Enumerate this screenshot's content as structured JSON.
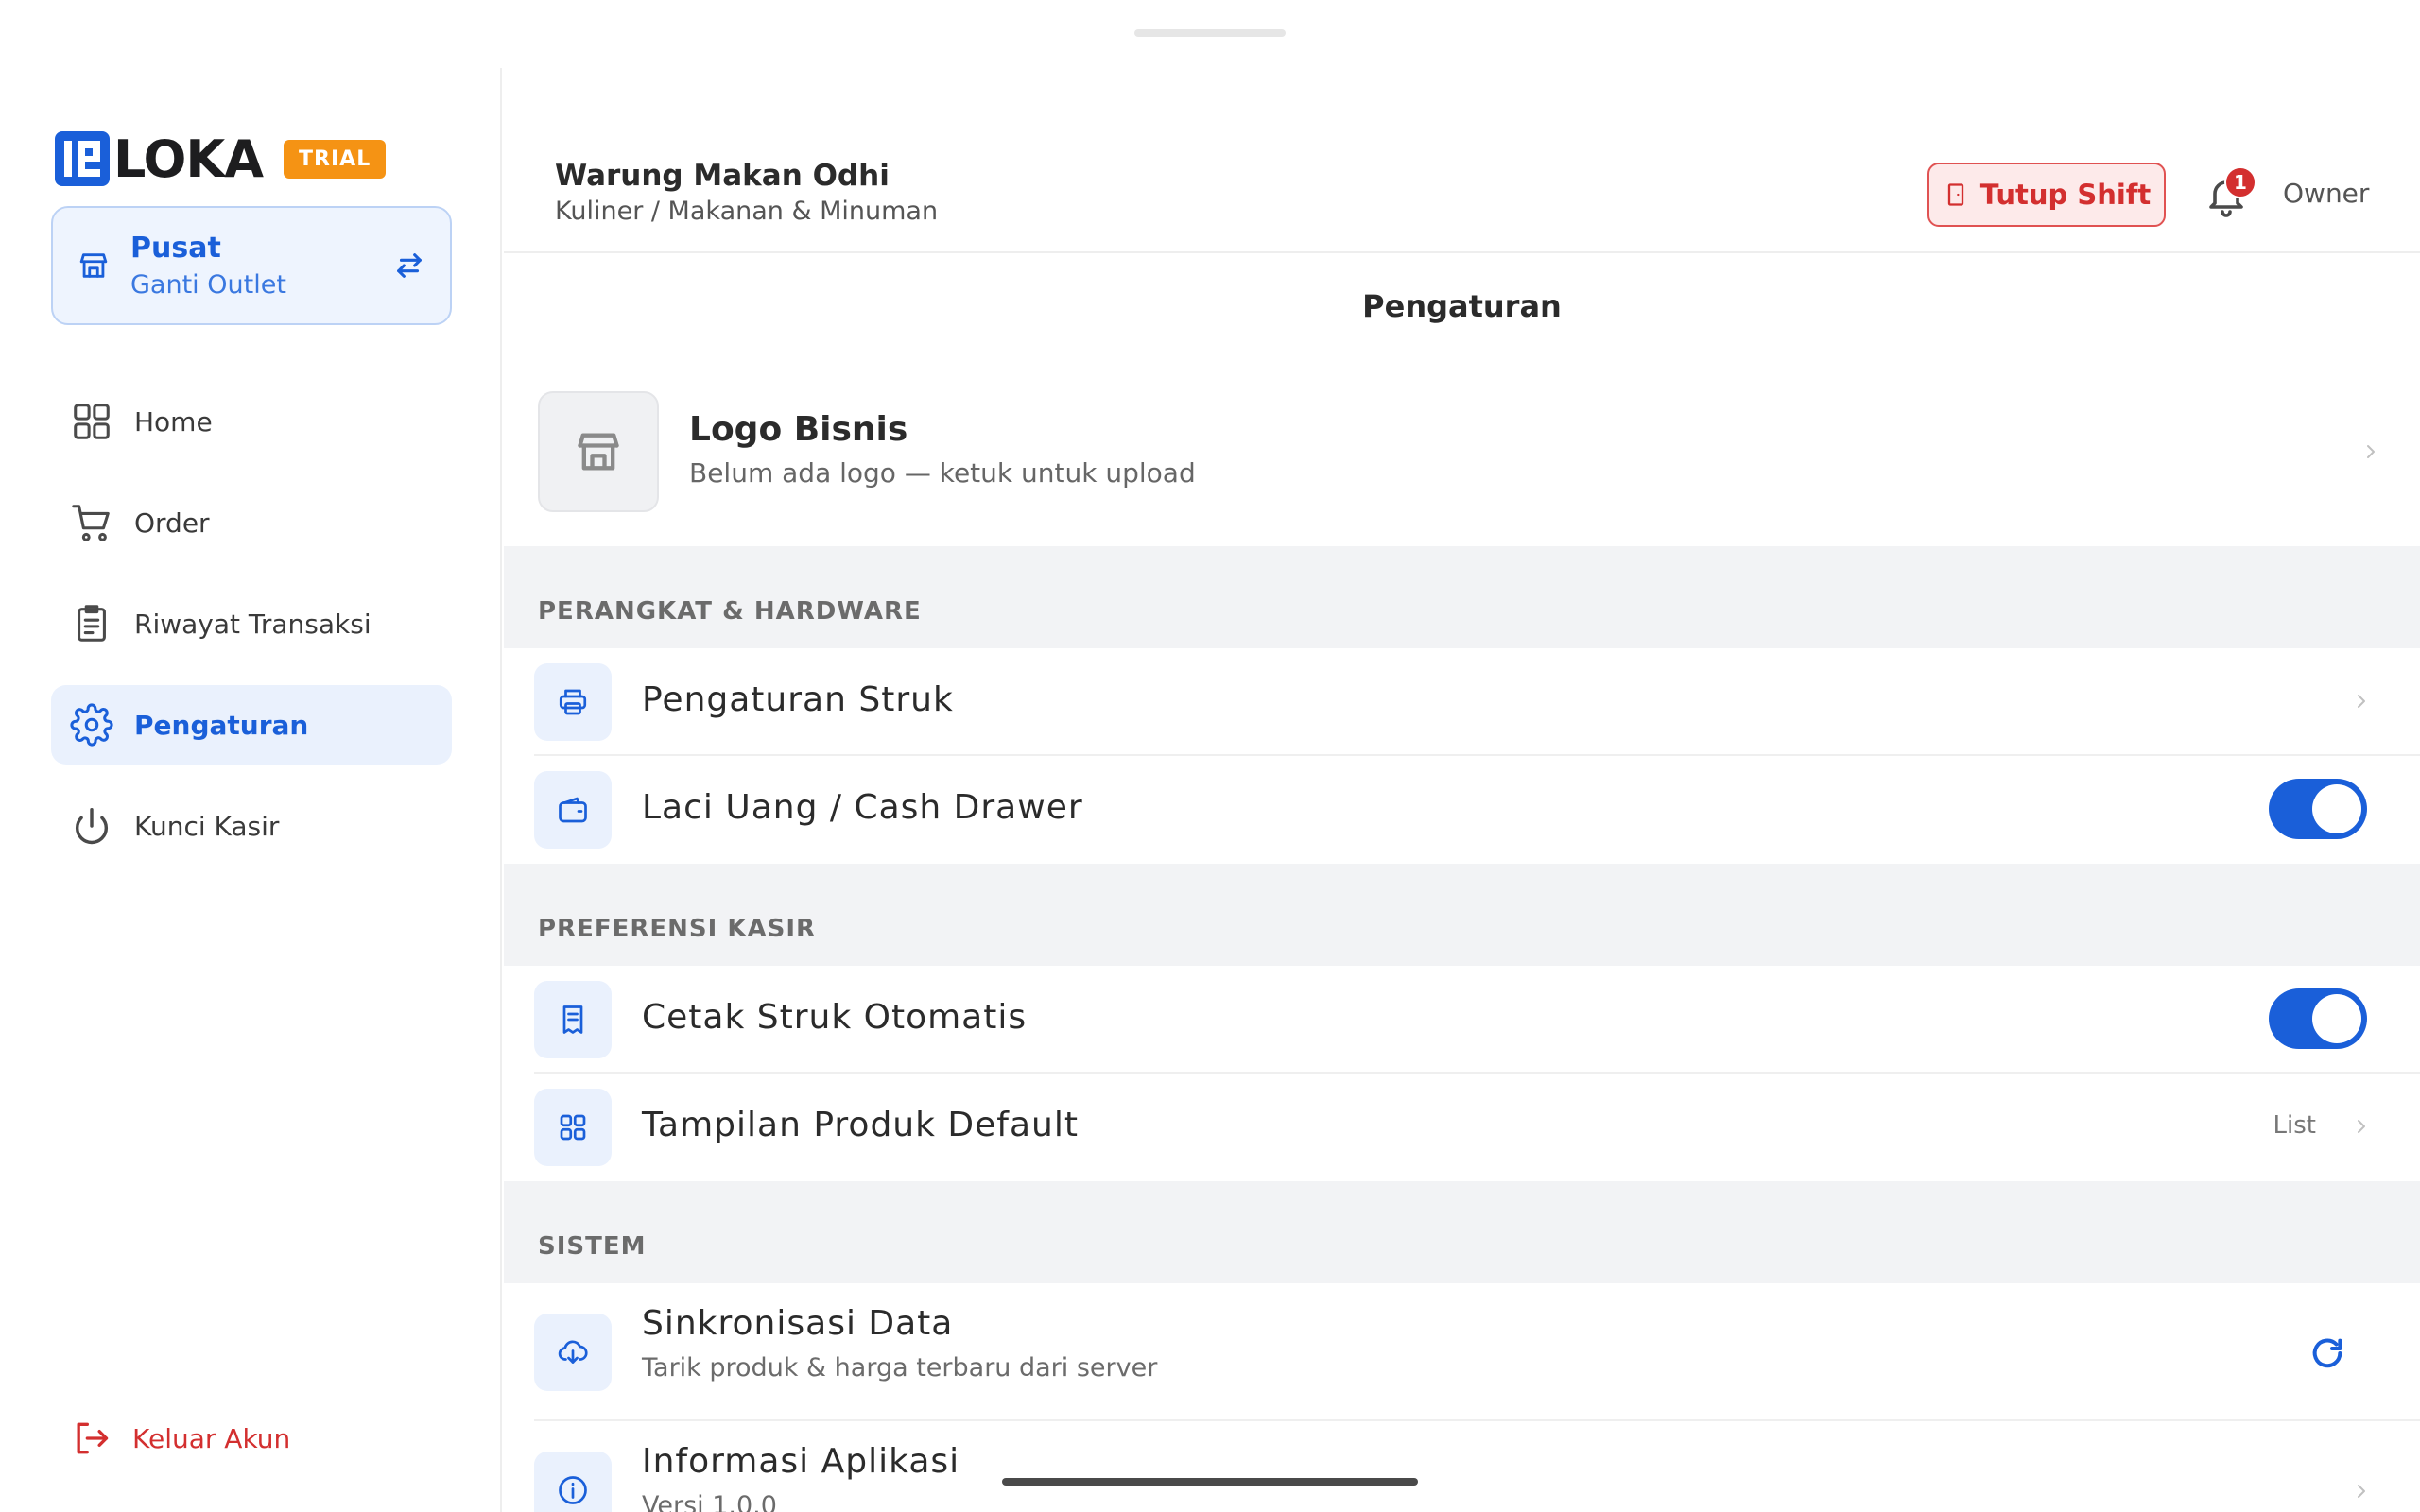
{
  "brand": {
    "name": "LOKA",
    "badge": "TRIAL"
  },
  "outlet": {
    "name": "Pusat",
    "action": "Ganti Outlet"
  },
  "nav": {
    "items": [
      {
        "label": "Home",
        "icon": "grid-icon"
      },
      {
        "label": "Order",
        "icon": "cart-icon"
      },
      {
        "label": "Riwayat Transaksi",
        "icon": "clipboard-icon"
      },
      {
        "label": "Pengaturan",
        "icon": "gear-icon",
        "active": true
      },
      {
        "label": "Kunci Kasir",
        "icon": "power-icon"
      }
    ],
    "logout": "Keluar Akun"
  },
  "header": {
    "business_name": "Warung Makan Odhi",
    "business_category": "Kuliner / Makanan & Minuman",
    "close_shift": "Tutup Shift",
    "notification_count": "1",
    "role": "Owner"
  },
  "page": {
    "title": "Pengaturan",
    "logo": {
      "title": "Logo Bisnis",
      "subtitle": "Belum ada logo — ketuk untuk upload"
    },
    "sections": {
      "hardware": {
        "label": "PERANGKAT & HARDWARE",
        "receipt_settings": "Pengaturan Struk",
        "cash_drawer": "Laci Uang / Cash Drawer",
        "cash_drawer_enabled": true
      },
      "cashier": {
        "label": "PREFERENSI KASIR",
        "auto_print": "Cetak Struk Otomatis",
        "auto_print_enabled": true,
        "default_view": "Tampilan Produk Default",
        "default_view_value": "List"
      },
      "system": {
        "label": "SISTEM",
        "sync_title": "Sinkronisasi Data",
        "sync_subtitle": "Tarik produk & harga terbaru dari server",
        "app_info_title": "Informasi Aplikasi",
        "app_info_subtitle": "Versi 1.0.0"
      }
    }
  },
  "colors": {
    "accent": "#1a5fd9",
    "danger": "#d32f2f",
    "trial": "#f59314"
  }
}
